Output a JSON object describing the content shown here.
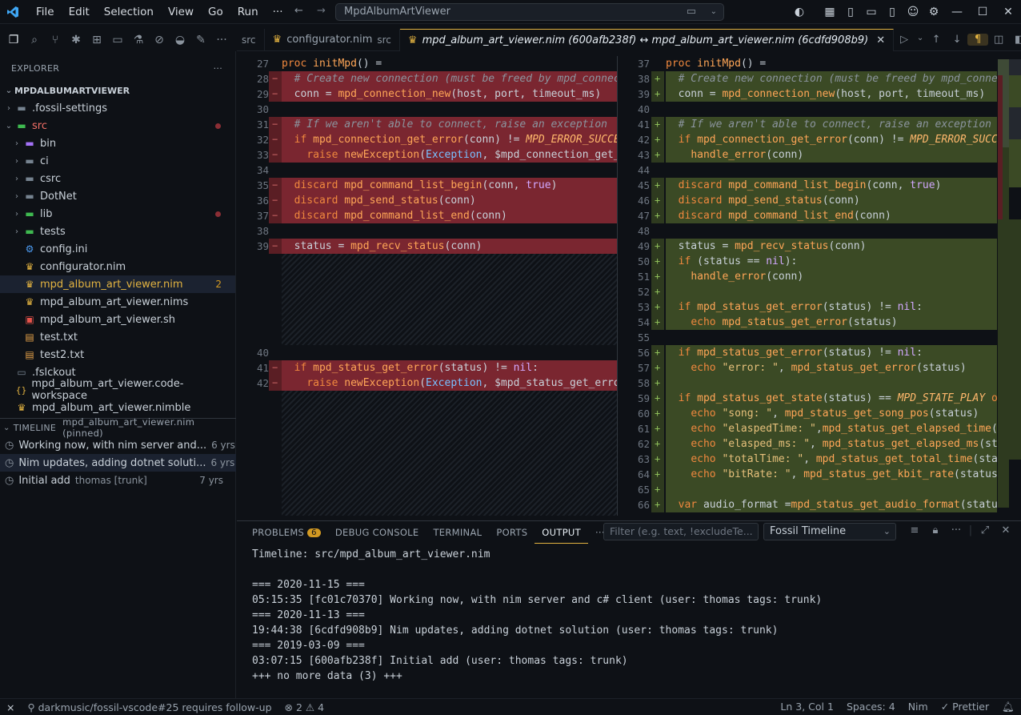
{
  "app": {
    "search_text": "MpdAlbumArtViewer"
  },
  "menu": [
    "File",
    "Edit",
    "Selection",
    "View",
    "Go",
    "Run",
    "···"
  ],
  "explorer": {
    "title": "EXPLORER",
    "root": "MPDALBUMARTVIEWER",
    "items": [
      {
        "label": ".fossil-settings",
        "kind": "folder",
        "depth": 1,
        "chev": "›"
      },
      {
        "label": "src",
        "kind": "folder-open",
        "depth": 1,
        "chev": "⌄",
        "dot": true
      },
      {
        "label": "bin",
        "kind": "folder",
        "depth": 2,
        "chev": "›"
      },
      {
        "label": "ci",
        "kind": "folder",
        "depth": 2,
        "chev": "›"
      },
      {
        "label": "csrc",
        "kind": "folder",
        "depth": 2,
        "chev": "›"
      },
      {
        "label": "DotNet",
        "kind": "folder",
        "depth": 2,
        "chev": "›"
      },
      {
        "label": "lib",
        "kind": "folder",
        "depth": 2,
        "chev": "›",
        "dot": true
      },
      {
        "label": "tests",
        "kind": "folder",
        "depth": 2,
        "chev": "›"
      },
      {
        "label": "config.ini",
        "kind": "gear",
        "depth": 2
      },
      {
        "label": "configurator.nim",
        "kind": "crown",
        "depth": 2
      },
      {
        "label": "mpd_album_art_viewer.nim",
        "kind": "crown",
        "depth": 2,
        "selected": true,
        "badge": "2"
      },
      {
        "label": "mpd_album_art_viewer.nims",
        "kind": "crown",
        "depth": 2
      },
      {
        "label": "mpd_album_art_viewer.sh",
        "kind": "shell",
        "depth": 2
      },
      {
        "label": "test.txt",
        "kind": "txt",
        "depth": 2
      },
      {
        "label": "test2.txt",
        "kind": "txt",
        "depth": 2
      },
      {
        "label": ".fslckout",
        "kind": "file",
        "depth": 1
      },
      {
        "label": "mpd_album_art_viewer.code-workspace",
        "kind": "json",
        "depth": 1
      },
      {
        "label": "mpd_album_art_viewer.nimble",
        "kind": "crown",
        "depth": 1
      }
    ]
  },
  "timeline": {
    "title": "TIMELINE",
    "subtitle": "mpd_album_art_viewer.nim (pinned)",
    "entries": [
      {
        "msg": "Working now, with nim server and...",
        "meta": "",
        "age": "6 yrs"
      },
      {
        "msg": "Nim updates, adding dotnet soluti...",
        "meta": "",
        "age": "6 yrs",
        "hover": true
      },
      {
        "msg": "Initial add",
        "meta": "thomas [trunk]",
        "age": "7 yrs"
      }
    ]
  },
  "tabs": [
    {
      "label": "src",
      "desc": "",
      "partial": true
    },
    {
      "label": "configurator.nim",
      "desc": "src"
    },
    {
      "label": "mpd_album_art_viewer.nim (600afb238f) ↔ mpd_album_art_viewer.nim (6cdfd908b9)",
      "active": true
    }
  ],
  "panel": {
    "tabs": [
      "PROBLEMS",
      "DEBUG CONSOLE",
      "TERMINAL",
      "PORTS",
      "OUTPUT"
    ],
    "problems_count": "6",
    "filter_placeholder": "Filter (e.g. text, !excludeTe...",
    "channel": "Fossil Timeline",
    "output": [
      "Timeline: src/mpd_album_art_viewer.nim",
      "",
      "=== 2020-11-15 ===",
      "05:15:35 [fc01c70370] Working now, with nim server and c# client (user: thomas tags: trunk)",
      "=== 2020-11-13 ===",
      "19:44:38 [6cdfd908b9] Nim updates, adding dotnet solution (user: thomas tags: trunk)",
      "=== 2019-03-09 ===",
      "03:07:15 [600afb238f] Initial add (user: thomas tags: trunk)",
      "+++ no more data (3) +++"
    ]
  },
  "status": {
    "branch": "darkmusic/fossil-vscode#25 requires follow-up",
    "errors": "2",
    "warnings": "4",
    "position": "Ln 3, Col 1",
    "spaces": "Spaces: 4",
    "language": "Nim",
    "formatter": "Prettier"
  }
}
